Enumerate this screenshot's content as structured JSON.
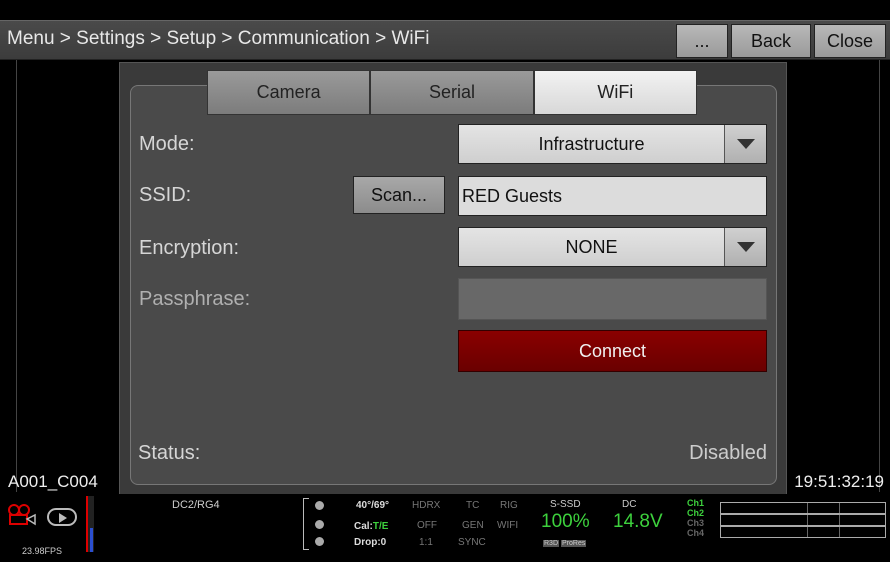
{
  "topbar": {
    "breadcrumb": "Menu > Settings > Setup > Communication > WiFi",
    "more_label": "...",
    "back_label": "Back",
    "close_label": "Close"
  },
  "tabs": [
    {
      "label": "Camera",
      "active": false
    },
    {
      "label": "Serial",
      "active": false
    },
    {
      "label": "WiFi",
      "active": true
    }
  ],
  "form": {
    "mode_label": "Mode:",
    "mode_value": "Infrastructure",
    "ssid_label": "SSID:",
    "scan_label": "Scan...",
    "ssid_value": "RED Guests",
    "encryption_label": "Encryption:",
    "encryption_value": "NONE",
    "passphrase_label": "Passphrase:",
    "passphrase_value": "",
    "connect_label": "Connect",
    "status_label": "Status:",
    "status_value": "Disabled"
  },
  "overlay": {
    "clip_name": "A001_C004",
    "timecode": "19:51:32:19"
  },
  "statusbar": {
    "fps": "23.98FPS",
    "lut": "DC2/RG4",
    "temperature": "40°/69°",
    "cal_label": "Cal:",
    "cal_value": "T/E",
    "drop": "Drop:0",
    "col_hdrx": [
      "HDRX",
      "OFF",
      "1:1"
    ],
    "col_tc": [
      "TC",
      "GEN",
      "SYNC"
    ],
    "col_rig": [
      "RIG",
      "WIFI"
    ],
    "media_label": "S-SSD",
    "media_value": "100%",
    "codec_r3d": "R3D",
    "codec_prores": "ProRes",
    "power_label": "DC",
    "power_value": "14.8V",
    "channels": [
      {
        "label": "Ch1",
        "on": true
      },
      {
        "label": "Ch2",
        "on": true
      },
      {
        "label": "Ch3",
        "on": false
      },
      {
        "label": "Ch4",
        "on": false
      }
    ]
  },
  "colors": {
    "accent_green": "#3dd13d",
    "connect_red": "#8a0000",
    "record_red": "#d00000"
  },
  "icons": [
    "camera-record-icon",
    "play-icon"
  ]
}
